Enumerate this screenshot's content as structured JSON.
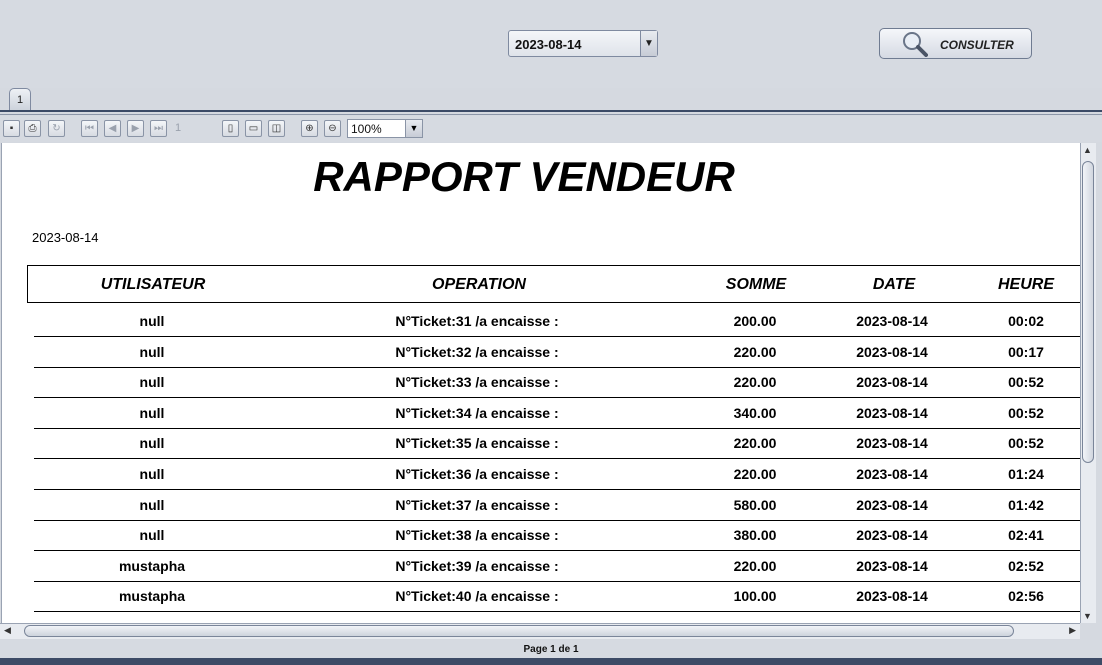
{
  "filter": {
    "date": "2023-08-14",
    "consult_label": "CONSULTER"
  },
  "tabs": [
    {
      "label": "1"
    }
  ],
  "toolbar": {
    "page_number": "1",
    "zoom": "100%"
  },
  "report": {
    "title": "RAPPORT VENDEUR",
    "date": "2023-08-14",
    "columns": [
      "UTILISATEUR",
      "OPERATION",
      "SOMME",
      "DATE",
      "HEURE"
    ],
    "rows": [
      {
        "user": "null",
        "op": "N°Ticket:31 /a encaisse :",
        "sum": "200.00",
        "date": "2023-08-14",
        "time": "00:02"
      },
      {
        "user": "null",
        "op": "N°Ticket:32 /a encaisse :",
        "sum": "220.00",
        "date": "2023-08-14",
        "time": "00:17"
      },
      {
        "user": "null",
        "op": "N°Ticket:33 /a encaisse :",
        "sum": "220.00",
        "date": "2023-08-14",
        "time": "00:52"
      },
      {
        "user": "null",
        "op": "N°Ticket:34 /a encaisse :",
        "sum": "340.00",
        "date": "2023-08-14",
        "time": "00:52"
      },
      {
        "user": "null",
        "op": "N°Ticket:35 /a encaisse :",
        "sum": "220.00",
        "date": "2023-08-14",
        "time": "00:52"
      },
      {
        "user": "null",
        "op": "N°Ticket:36 /a encaisse :",
        "sum": "220.00",
        "date": "2023-08-14",
        "time": "01:24"
      },
      {
        "user": "null",
        "op": "N°Ticket:37 /a encaisse :",
        "sum": "580.00",
        "date": "2023-08-14",
        "time": "01:42"
      },
      {
        "user": "null",
        "op": "N°Ticket:38 /a encaisse :",
        "sum": "380.00",
        "date": "2023-08-14",
        "time": "02:41"
      },
      {
        "user": "mustapha",
        "op": "N°Ticket:39 /a encaisse :",
        "sum": "220.00",
        "date": "2023-08-14",
        "time": "02:52"
      },
      {
        "user": "mustapha",
        "op": "N°Ticket:40 /a encaisse :",
        "sum": "100.00",
        "date": "2023-08-14",
        "time": "02:56"
      }
    ]
  },
  "status": {
    "page_info": "Page 1 de 1"
  },
  "icons": {
    "save": "save-icon",
    "print": "print-icon",
    "reload": "reload-icon",
    "first": "first-page-icon",
    "prev": "previous-page-icon",
    "next": "next-page-icon",
    "last": "last-page-icon",
    "actual_size": "actual-size-icon",
    "fit_page": "fit-page-icon",
    "fit_width": "fit-width-icon",
    "zoom_in": "zoom-in-icon",
    "zoom_out": "zoom-out-icon",
    "search": "search-icon"
  }
}
